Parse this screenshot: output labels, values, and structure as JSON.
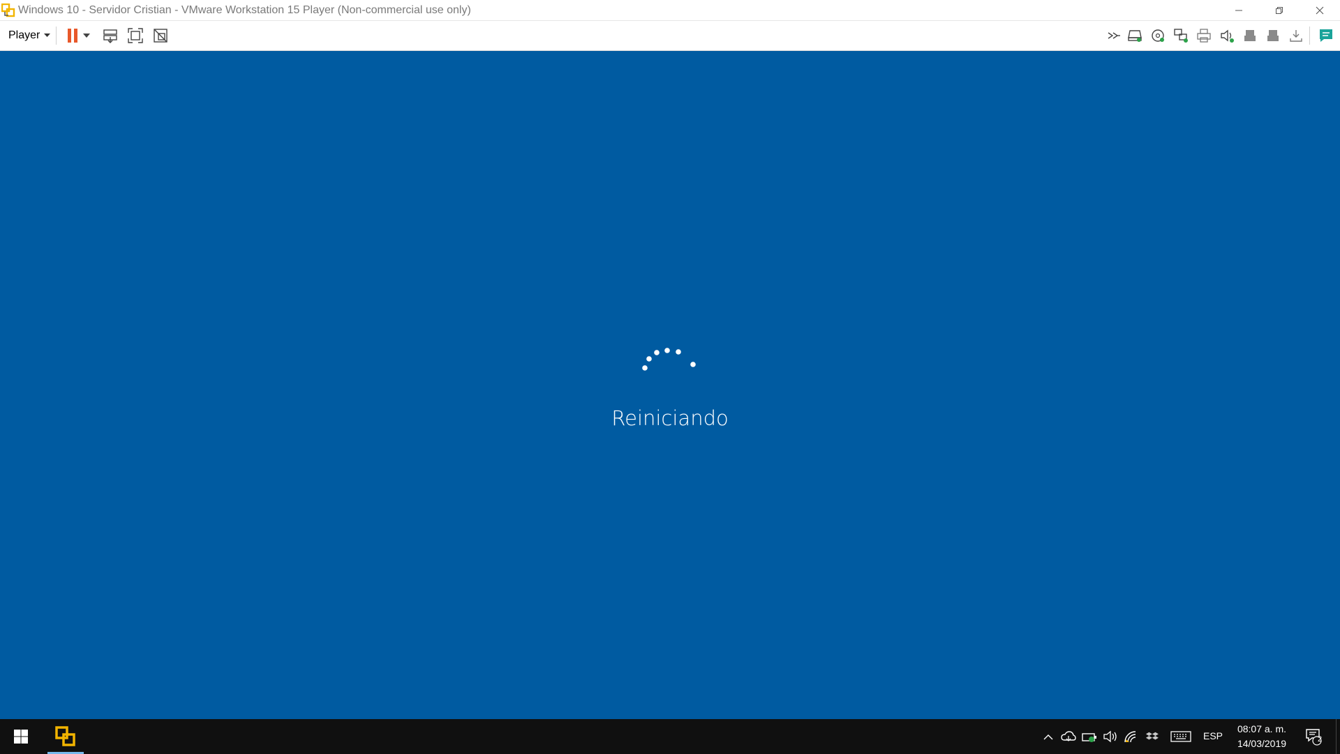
{
  "window": {
    "title": "Windows 10 - Servidor Cristian - VMware Workstation 15 Player (Non-commercial use only)",
    "controls": [
      "minimize-icon",
      "restore-icon",
      "close-icon"
    ]
  },
  "toolbar": {
    "player_menu_label": "Player",
    "left_icons": [
      "pause-icon",
      "dropdown-caret-icon",
      "send-ctrl-alt-del-icon",
      "full-screen-icon",
      "unity-icon"
    ],
    "device_icons": [
      "more-devices-icon",
      "hard-disk-icon",
      "cd-dvd-icon",
      "network-adapter-icon",
      "printer-icon",
      "sound-card-icon",
      "usb-device-icon",
      "usb-device-2-icon",
      "usb-eject-icon",
      "message-log-icon"
    ],
    "accent_pause": "#e8582a",
    "accent_device_active": "#2ca24a",
    "accent_message": "#1aa39a"
  },
  "vm_screen": {
    "background": "#005ba1",
    "status_text": "Reiniciando",
    "spinner": "loading-dots-spinner"
  },
  "taskbar": {
    "start": "windows-start-icon",
    "pinned": [
      {
        "name": "vmware-player",
        "icon": "vmware-icon",
        "active": true
      }
    ],
    "tray_icons": [
      "show-hidden-icons-chevron",
      "onedrive-cloud-icon",
      "battery-icon",
      "volume-icon",
      "wifi-icon",
      "dropbox-icon",
      "touch-keyboard-icon"
    ],
    "language": "ESP",
    "time": "08:07 a. m.",
    "date": "14/03/2019",
    "notifications_count": "2"
  }
}
